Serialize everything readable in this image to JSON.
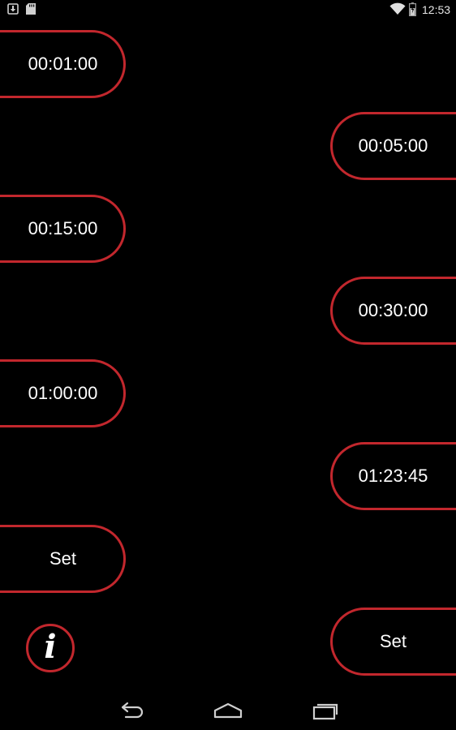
{
  "status_bar": {
    "time": "12:53",
    "icons": [
      "download-icon",
      "sd-card-icon",
      "wifi-icon",
      "battery-icon"
    ]
  },
  "presets": {
    "p1": "00:01:00",
    "p2": "00:05:00",
    "p3": "00:15:00",
    "p4": "00:30:00",
    "p5": "01:00:00",
    "p6": "01:23:45",
    "set_left": "Set",
    "set_right": "Set"
  },
  "info_button": {
    "glyph": "i",
    "icon": "info-icon"
  },
  "nav_bar": {
    "icons": [
      "back-icon",
      "home-icon",
      "recent-apps-icon"
    ]
  },
  "colors": {
    "accent": "#c2272d",
    "background": "#000000",
    "text": "#ffffff"
  }
}
